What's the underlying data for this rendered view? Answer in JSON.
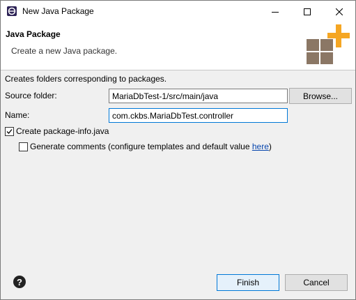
{
  "window": {
    "title": "New Java Package"
  },
  "header": {
    "title": "Java Package",
    "description": "Create a new Java package."
  },
  "form": {
    "section_description": "Creates folders corresponding to packages.",
    "source_folder_label": "Source folder:",
    "source_folder_value": "MariaDbTest-1/src/main/java",
    "browse_label": "Browse...",
    "name_label": "Name:",
    "name_value": "com.ckbs.MariaDbTest.controller",
    "create_package_info": {
      "label": "Create package-info.java",
      "checked": true
    },
    "generate_comments": {
      "label_before": "Generate comments (configure templates and default value ",
      "link_text": "here",
      "label_after": ")",
      "checked": false
    }
  },
  "footer": {
    "finish_label": "Finish",
    "cancel_label": "Cancel"
  },
  "colors": {
    "accent": "#0078d7",
    "icon_brown": "#8b7765",
    "icon_orange": "#f5a623"
  },
  "icons": {
    "app": "eclipse-icon",
    "help": "help-icon",
    "wizard": "package-add-icon"
  }
}
